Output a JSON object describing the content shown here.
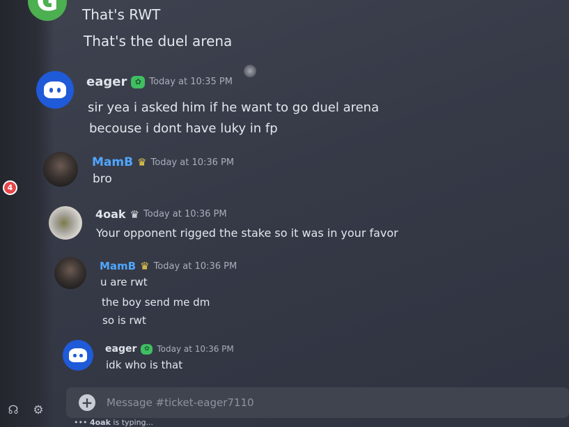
{
  "sidebar": {
    "unread_count": "4",
    "icons": [
      "headset-icon",
      "gear-icon"
    ]
  },
  "messages": [
    {
      "id": "m0",
      "author": "",
      "avatar": "google-icon",
      "lines": [
        "That's RWT",
        "That's the duel arena"
      ]
    },
    {
      "id": "m1",
      "author": "eager",
      "badge": "green-badge",
      "timestamp": "Today at 10:35 PM",
      "lines": [
        "sir yea i asked him if he want to go duel arena",
        "becouse i dont have luky in fp"
      ]
    },
    {
      "id": "m2",
      "author": "MamB",
      "badge": "crown",
      "timestamp": "Today at 10:36 PM",
      "lines": [
        "bro"
      ]
    },
    {
      "id": "m3",
      "author": "4oak",
      "badge": "crown",
      "timestamp": "Today at 10:36 PM",
      "lines": [
        "Your opponent rigged the stake so it was in your favor"
      ]
    },
    {
      "id": "m4",
      "author": "MamB",
      "badge": "crown",
      "timestamp": "Today at 10:36 PM",
      "lines": [
        "u are rwt",
        "the boy send me dm",
        "so is rwt"
      ]
    },
    {
      "id": "m5",
      "author": "eager",
      "badge": "green-badge",
      "timestamp": "Today at 10:36 PM",
      "lines": [
        "idk who is that"
      ]
    }
  ],
  "composer": {
    "placeholder": "Message #ticket-eager7110",
    "add_icon": "plus-icon"
  },
  "typing": {
    "user": "4oak",
    "suffix": " is typing..."
  },
  "colors": {
    "role_blue": "#4fa7ff",
    "discord_blurple": "#1f5ad8",
    "badge_green": "#3fbe62",
    "crown_gold": "#f3d34a",
    "unread_red": "#e8464a"
  }
}
